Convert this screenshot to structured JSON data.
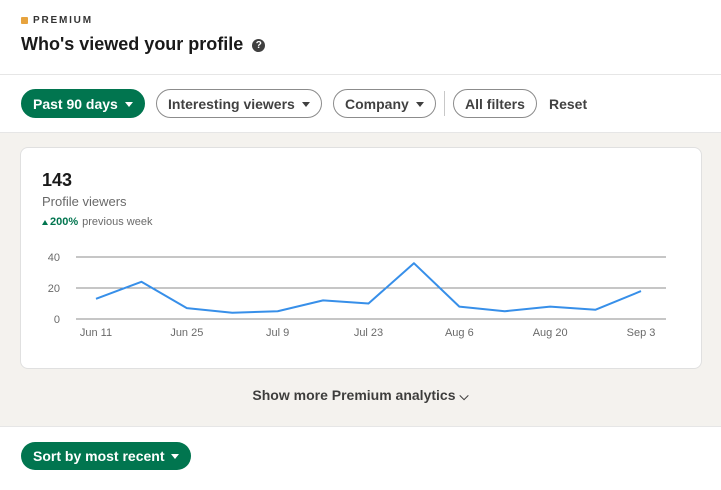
{
  "header": {
    "premium_label": "PREMIUM",
    "title": "Who's viewed your profile",
    "help_glyph": "?"
  },
  "filters": {
    "time_range": "Past 90 days",
    "viewers": "Interesting viewers",
    "company": "Company",
    "all_filters": "All filters",
    "reset": "Reset"
  },
  "stats": {
    "count": "143",
    "label": "Profile viewers",
    "change": "200%",
    "change_suffix": "previous week"
  },
  "chart_data": {
    "type": "line",
    "title": "",
    "xlabel": "",
    "ylabel": "",
    "ylim": [
      0,
      40
    ],
    "yticks": [
      0,
      20,
      40
    ],
    "x_tick_labels": [
      "Jun 11",
      "Jun 25",
      "Jul 9",
      "Jul 23",
      "Aug 6",
      "Aug 20",
      "Sep 3"
    ],
    "x": [
      "Jun 11",
      "Jun 18",
      "Jun 25",
      "Jul 2",
      "Jul 9",
      "Jul 16",
      "Jul 23",
      "Jul 30",
      "Aug 6",
      "Aug 13",
      "Aug 20",
      "Aug 27",
      "Sep 3"
    ],
    "series": [
      {
        "values": [
          13,
          24,
          7,
          4,
          5,
          12,
          10,
          36,
          8,
          5,
          8,
          6,
          18
        ]
      }
    ],
    "grid": true,
    "line_color": "#378fe9"
  },
  "show_more": "Show more Premium analytics",
  "show_more_icon": "chevron-down-icon",
  "sort": "Sort by most recent",
  "colors": {
    "primary": "#01754f",
    "premium": "#e7a33e",
    "line": "#378fe9"
  }
}
